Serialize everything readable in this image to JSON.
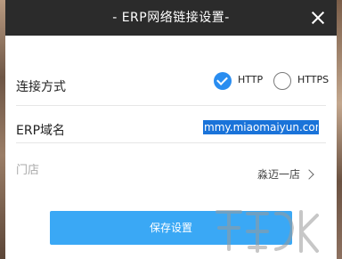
{
  "window": {
    "title": "- ERP网络链接设置-",
    "close_icon": "close-icon"
  },
  "connection": {
    "label": "连接方式",
    "options": [
      {
        "label": "HTTP",
        "selected": true
      },
      {
        "label": "HTTPS",
        "selected": false
      }
    ]
  },
  "domain": {
    "label": "ERP域名",
    "value": "mmy.miaomaiyun.com"
  },
  "store": {
    "label": "门店",
    "value": "淼迈一店",
    "chevron_icon": "chevron-right-icon"
  },
  "actions": {
    "save_label": "保存设置"
  },
  "colors": {
    "titlebar": "#2b2b2b",
    "accent": "#2a8df0",
    "save_button": "#3aa8f5",
    "selection": "#1a73d9"
  }
}
